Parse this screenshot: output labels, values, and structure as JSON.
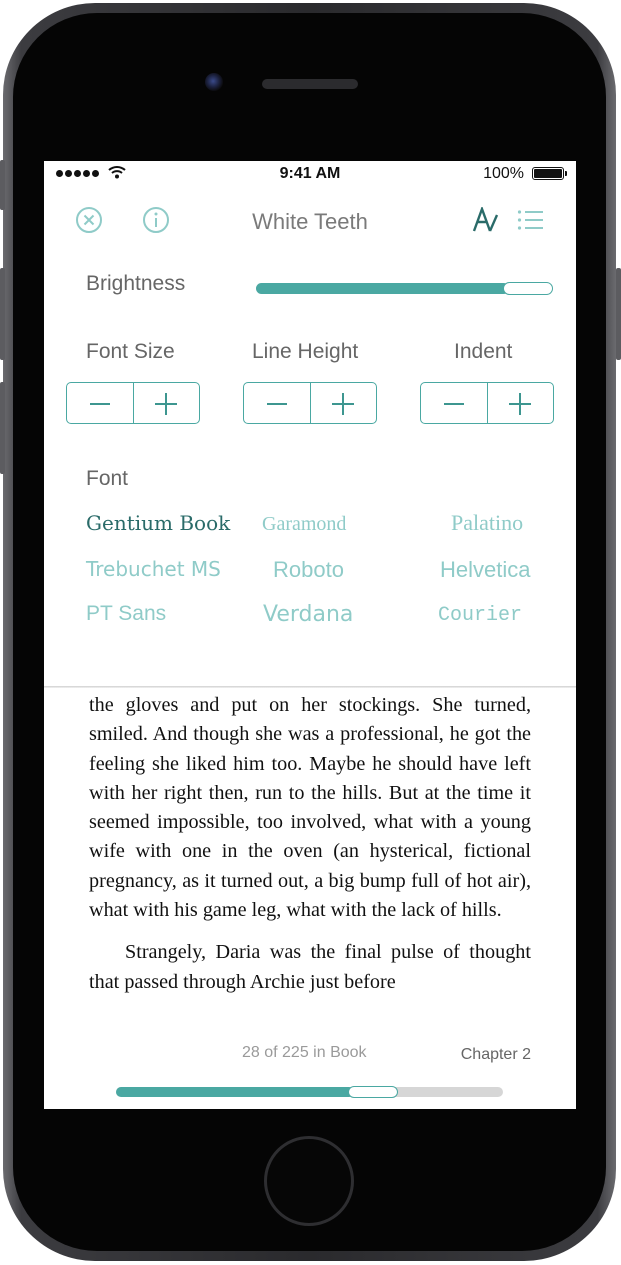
{
  "status_bar": {
    "time": "9:41 AM",
    "battery": "100%"
  },
  "nav": {
    "title": "White Teeth",
    "icons": [
      "close-icon",
      "info-icon",
      "font-settings-icon",
      "table-of-contents-icon"
    ]
  },
  "settings": {
    "brightness_label": "Brightness",
    "brightness_level": 0.83,
    "font_size_label": "Font Size",
    "line_height_label": "Line Height",
    "indent_label": "Indent",
    "font_label": "Font",
    "fonts": [
      "Gentium Book",
      "Garamond",
      "Palatino",
      "Trebuchet MS",
      "Roboto",
      "Helvetica",
      "PT Sans",
      "Verdana",
      "Courier"
    ],
    "selected_font": "Gentium Book",
    "accent_color": "#4aa8a2"
  },
  "book": {
    "paragraph_1": "the gloves and put on her stockings. She turned, smiled. And though she was a professional, he got the feeling she liked him too. Maybe he should have left with her right then, run to the hills. But at the time it seemed impossible, too involved, what with a young wife with one in the oven (an hysterical, fictional pregnancy, as it turned out, a big bump full of hot air), what with his game leg, what with the lack of hills.",
    "paragraph_2": "Strangely, Daria was the final pulse of thought that passed through Archie just before",
    "page_info": "28 of 225 in Book",
    "chapter": "Chapter 2",
    "reading_progress": 0.6
  }
}
